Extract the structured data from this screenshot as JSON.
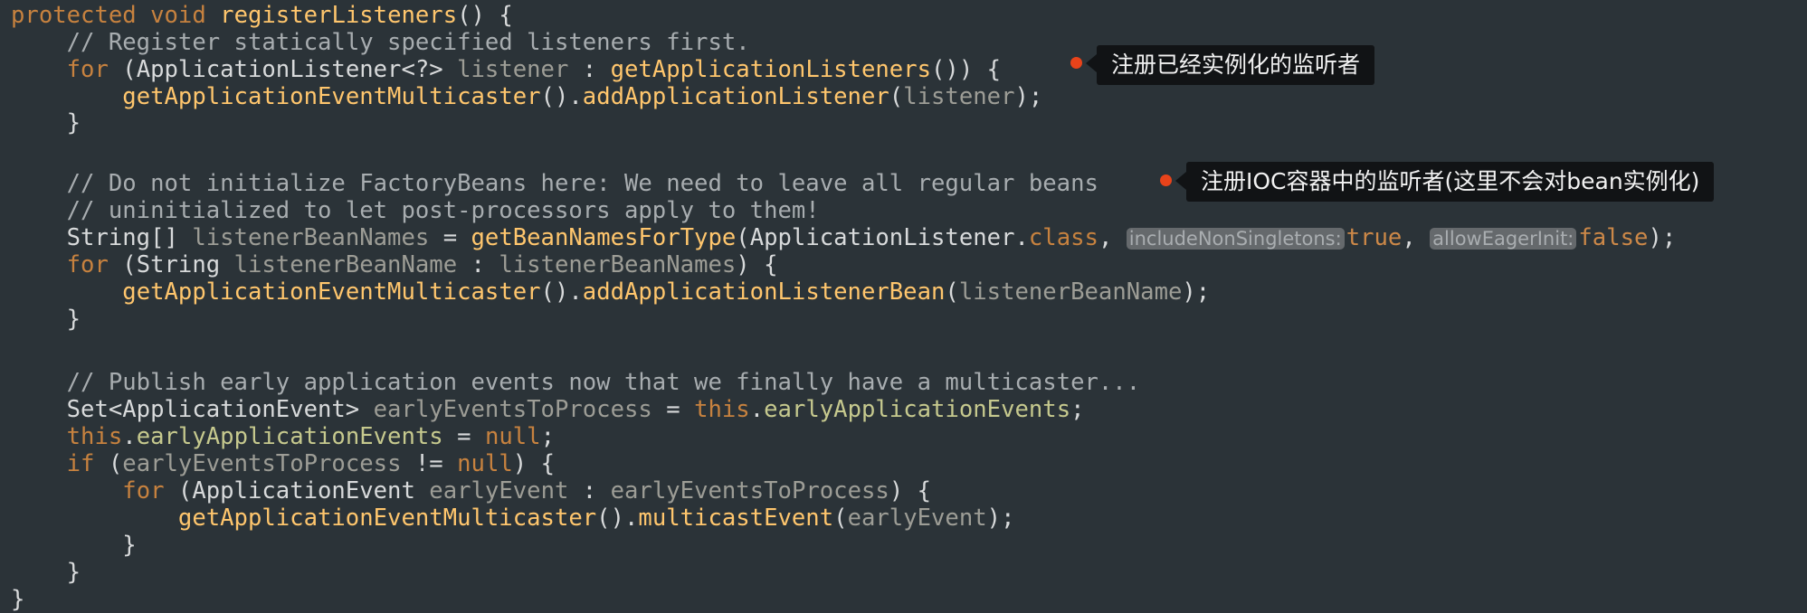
{
  "code": [
    [
      [
        "kw",
        "protected"
      ],
      [
        "pn",
        " "
      ],
      [
        "kw",
        "void"
      ],
      [
        "pn",
        " "
      ],
      [
        "fn",
        "registerListeners"
      ],
      [
        "pn",
        "() {"
      ]
    ],
    [
      [
        "pn",
        "    "
      ],
      [
        "cm",
        "// Register statically specified listeners first."
      ]
    ],
    [
      [
        "pn",
        "    "
      ],
      [
        "kw",
        "for"
      ],
      [
        "pn",
        " (ApplicationListener<?> "
      ],
      [
        "var",
        "listener"
      ],
      [
        "pn",
        " : "
      ],
      [
        "fn",
        "getApplicationListeners"
      ],
      [
        "pn",
        "()) {"
      ]
    ],
    [
      [
        "pn",
        "        "
      ],
      [
        "fn",
        "getApplicationEventMulticaster"
      ],
      [
        "pn",
        "()."
      ],
      [
        "fn",
        "addApplicationListener"
      ],
      [
        "pn",
        "("
      ],
      [
        "var",
        "listener"
      ],
      [
        "pn",
        ");"
      ]
    ],
    [
      [
        "pn",
        "    }"
      ]
    ],
    [
      [
        "pn",
        ""
      ]
    ],
    [
      [
        "pn",
        "    "
      ],
      [
        "cm",
        "// Do not initialize FactoryBeans here: We need to leave all regular beans"
      ]
    ],
    [
      [
        "pn",
        "    "
      ],
      [
        "cm",
        "// uninitialized to let post-processors apply to them!"
      ]
    ],
    [
      [
        "pn",
        "    String[] "
      ],
      [
        "var",
        "listenerBeanNames"
      ],
      [
        "pn",
        " = "
      ],
      [
        "fn",
        "getBeanNamesForType"
      ],
      [
        "pn",
        "(ApplicationListener."
      ],
      [
        "kw",
        "class"
      ],
      [
        "pn",
        ", "
      ],
      [
        "hint",
        "includeNonSingletons:"
      ],
      [
        "lit",
        "true"
      ],
      [
        "pn",
        ", "
      ],
      [
        "hint",
        "allowEagerInit:"
      ],
      [
        "lit",
        "false"
      ],
      [
        "pn",
        ");"
      ]
    ],
    [
      [
        "pn",
        "    "
      ],
      [
        "kw",
        "for"
      ],
      [
        "pn",
        " (String "
      ],
      [
        "var",
        "listenerBeanName"
      ],
      [
        "pn",
        " : "
      ],
      [
        "var",
        "listenerBeanNames"
      ],
      [
        "pn",
        ") {"
      ]
    ],
    [
      [
        "pn",
        "        "
      ],
      [
        "fn",
        "getApplicationEventMulticaster"
      ],
      [
        "pn",
        "()."
      ],
      [
        "fn",
        "addApplicationListenerBean"
      ],
      [
        "pn",
        "("
      ],
      [
        "var",
        "listenerBeanName"
      ],
      [
        "pn",
        ");"
      ]
    ],
    [
      [
        "pn",
        "    }"
      ]
    ],
    [
      [
        "pn",
        ""
      ]
    ],
    [
      [
        "pn",
        "    "
      ],
      [
        "cm",
        "// Publish early application events now that we finally have a multicaster..."
      ]
    ],
    [
      [
        "pn",
        "    Set<ApplicationEvent> "
      ],
      [
        "var",
        "earlyEventsToProcess"
      ],
      [
        "pn",
        " = "
      ],
      [
        "kw",
        "this"
      ],
      [
        "pn",
        "."
      ],
      [
        "fld",
        "earlyApplicationEvents"
      ],
      [
        "pn",
        ";"
      ]
    ],
    [
      [
        "pn",
        "    "
      ],
      [
        "kw",
        "this"
      ],
      [
        "pn",
        "."
      ],
      [
        "fld",
        "earlyApplicationEvents"
      ],
      [
        "pn",
        " = "
      ],
      [
        "kw",
        "null"
      ],
      [
        "pn",
        ";"
      ]
    ],
    [
      [
        "pn",
        "    "
      ],
      [
        "kw",
        "if"
      ],
      [
        "pn",
        " ("
      ],
      [
        "var",
        "earlyEventsToProcess"
      ],
      [
        "pn",
        " != "
      ],
      [
        "kw",
        "null"
      ],
      [
        "pn",
        ") {"
      ]
    ],
    [
      [
        "pn",
        "        "
      ],
      [
        "kw",
        "for"
      ],
      [
        "pn",
        " (ApplicationEvent "
      ],
      [
        "var",
        "earlyEvent"
      ],
      [
        "pn",
        " : "
      ],
      [
        "var",
        "earlyEventsToProcess"
      ],
      [
        "pn",
        ") {"
      ]
    ],
    [
      [
        "pn",
        "            "
      ],
      [
        "fn",
        "getApplicationEventMulticaster"
      ],
      [
        "pn",
        "()."
      ],
      [
        "fn",
        "multicastEvent"
      ],
      [
        "pn",
        "("
      ],
      [
        "var",
        "earlyEvent"
      ],
      [
        "pn",
        ");"
      ]
    ],
    [
      [
        "pn",
        "        }"
      ]
    ],
    [
      [
        "pn",
        "    }"
      ]
    ],
    [
      [
        "pn",
        "}"
      ]
    ]
  ],
  "annotations": [
    {
      "text": "注册已经实例化的监听者",
      "dot_color": "#e8431a"
    },
    {
      "text": "注册IOC容器中的监听者(这里不会对bean实例化)",
      "dot_color": "#e8431a"
    }
  ],
  "colors": {
    "background": "#2b3338",
    "keyword": "#c7823f",
    "method": "#ffc66d",
    "comment": "#a8adb0",
    "variable": "#9d9d96",
    "field": "#c6c98e",
    "hint_background": "#65696c"
  }
}
